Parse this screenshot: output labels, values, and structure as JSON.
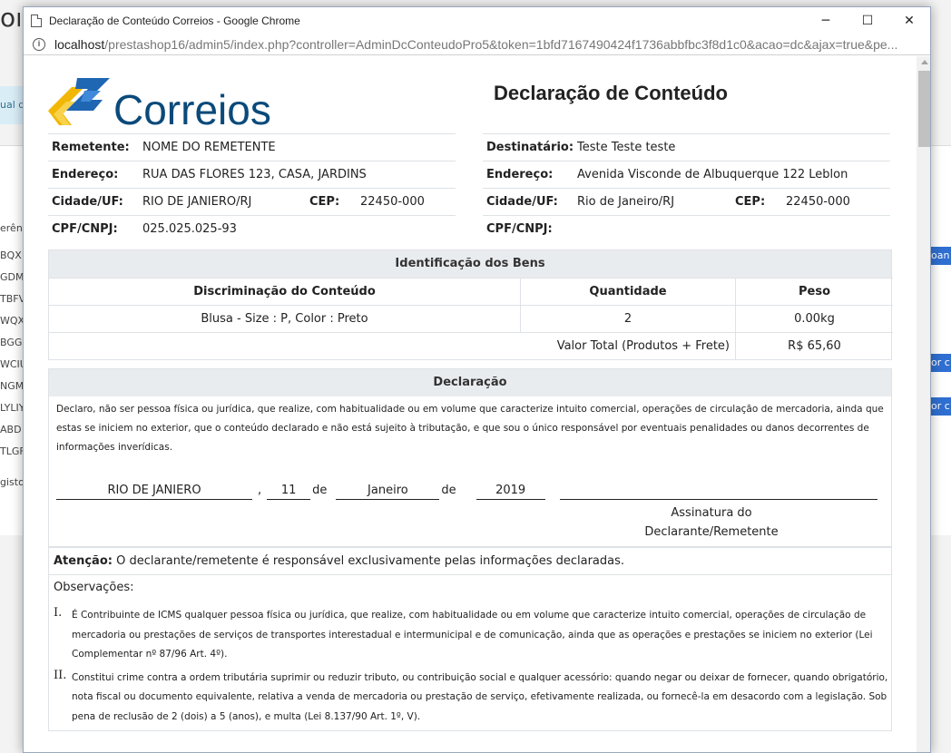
{
  "background": {
    "title_fragment": "ont",
    "info_fragment": "ual d",
    "rows": [
      "erên",
      "BQX",
      "GDM",
      "TBFV",
      "WQX",
      "BGG",
      "WCIU",
      "NGMI",
      "LYLIY",
      "ABD",
      "TLGF",
      "gistos"
    ],
    "right_buttons": [
      "oan",
      "or c",
      "or c"
    ]
  },
  "window": {
    "title": "Declaração de Conteúdo Correios - Google Chrome",
    "minimize": "─",
    "maximize": "☐",
    "close": "✕"
  },
  "address": {
    "host": "localhost",
    "path": "/prestashop16/admin5/index.php?controller=AdminDcConteudoPro5&token=1bfd7167490424f1736abbfbc3f8d1c0&acao=dc&ajax=true&pe..."
  },
  "logo": {
    "text": "Correios"
  },
  "doc_title": "Declaração de Conteúdo",
  "remetente": {
    "nome_label": "Remetente:",
    "nome": "NOME DO REMETENTE",
    "endereco_label": "Endereço:",
    "endereco": "RUA DAS FLORES 123, CASA, JARDINS",
    "cidade_label": "Cidade/UF:",
    "cidade": "RIO DE JANIERO/RJ",
    "cep_label": "CEP:",
    "cep": "22450-000",
    "cpf_label": "CPF/CNPJ:",
    "cpf": "025.025.025-93"
  },
  "destinatario": {
    "nome_label": "Destinatário:",
    "nome": "Teste Teste teste",
    "endereco_label": "Endereço:",
    "endereco": "Avenida Visconde de Albuquerque 122 Leblon",
    "cidade_label": "Cidade/UF:",
    "cidade": "Rio de Janeiro/RJ",
    "cep_label": "CEP:",
    "cep": "22450-000",
    "cpf_label": "CPF/CNPJ:",
    "cpf": ""
  },
  "bens": {
    "heading": "Identificação dos Bens",
    "col_discriminacao": "Discriminação do Conteúdo",
    "col_quantidade": "Quantidade",
    "col_peso": "Peso",
    "item_desc": "Blusa - Size : P, Color : Preto",
    "item_qtd": "2",
    "item_peso": "0.00kg",
    "total_label": "Valor Total (Produtos + Frete)",
    "total_value": "R$ 65,60"
  },
  "declaracao": {
    "heading": "Declaração",
    "text": "Declaro, não ser pessoa física ou jurídica, que realize, com habitualidade ou em volume que caracterize intuito comercial, operações de circulação de mercadoria, ainda que estas se iniciem no exterior, que o conteúdo declarado e não está sujeito à tributação, e que sou o único responsável por eventuais penalidades ou danos decorrentes de informações inverídicas.",
    "cidade": "RIO DE JANIERO",
    "comma": ",",
    "dia": "11",
    "de1": "de",
    "mes": "Janeiro",
    "de2": "de",
    "ano": "2019",
    "assinatura_1": "Assinatura do",
    "assinatura_2": "Declarante/Remetente"
  },
  "observacoes": {
    "atencao_label": "Atenção:",
    "atencao_text": " O declarante/remetente é responsável exclusivamente pelas informações declaradas.",
    "title": "Observações:",
    "item1_num": "I.",
    "item1": "É Contribuinte de ICMS qualquer pessoa física ou jurídica, que realize, com habitualidade ou em volume que caracterize intuito comercial, operações de circulação de mercadoria ou prestações de serviços de transportes interestadual e intermunicipal e de comunicação, ainda que as operações e prestações se iniciem no exterior (Lei Complementar nº 87/96 Art. 4º).",
    "item2_num": "II.",
    "item2": "Constitui crime contra a ordem tributária suprimir ou reduzir tributo, ou contribuição social e qualquer acessório: quando negar ou deixar de fornecer, quando obrigatório, nota fiscal ou documento equivalente, relativa a venda de mercadoria ou prestação de serviço, efetivamente realizada, ou fornecê-la em desacordo com a legislação. Sob pena de reclusão de 2 (dois) a 5 (anos), e multa (Lei 8.137/90 Art. 1º, V)."
  },
  "colors": {
    "correios_blue": "#0a4a7a",
    "correios_yellow": "#f7c200",
    "section_bg": "#e9ecef",
    "border": "#dee2e6"
  }
}
